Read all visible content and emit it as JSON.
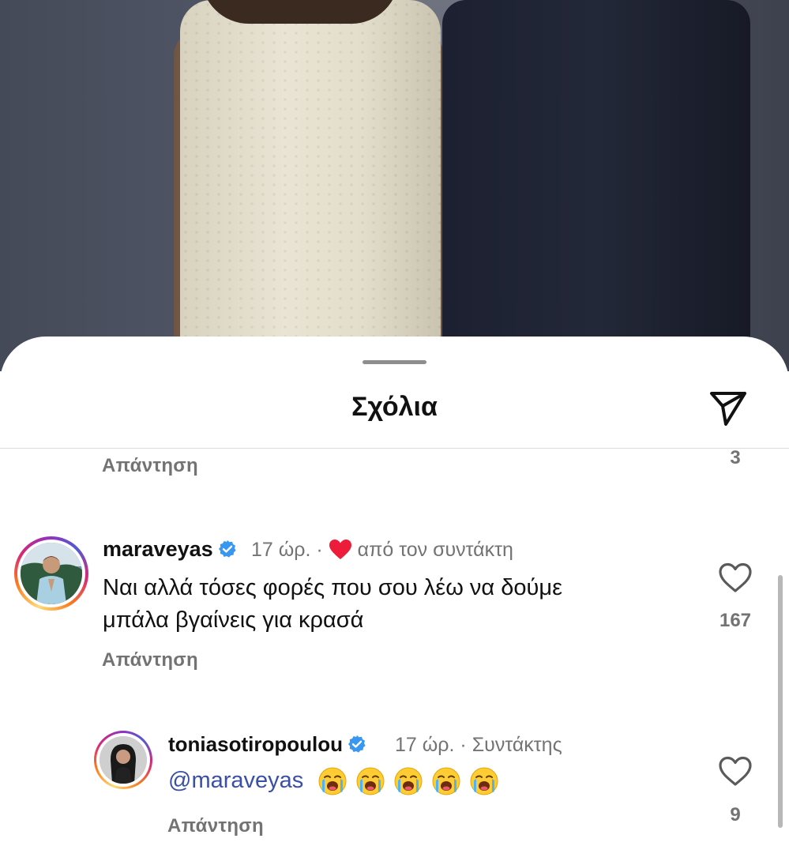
{
  "sheet": {
    "title": "Σχόλια",
    "share_icon": "paper-plane-icon"
  },
  "previous_comment": {
    "reply_label": "Απάντηση",
    "like_count": "3"
  },
  "comment_1": {
    "username": "maraveyas",
    "verified": true,
    "time": "17 ώρ.",
    "separator": "·",
    "liked_by_author_label": "από τον συντάκτη",
    "text_line1": "Ναι αλλά τόσες φορές που σου λέω να δούμε",
    "text_line2": "μπάλα βγαίνεις για κρασά",
    "like_count": "167",
    "reply_label": "Απάντηση"
  },
  "comment_2": {
    "username": "toniasotiropoulou",
    "verified": true,
    "time": "17 ώρ.",
    "separator": "·",
    "role_label": "Συντάκτης",
    "mention": "@maraveyas",
    "emoji_count": 5,
    "emoji_name": "loudly-crying-face",
    "like_count": "9",
    "reply_label": "Απάντηση"
  },
  "colors": {
    "verified_blue": "#3897f0",
    "heart_red": "#ed1c3a",
    "mention_blue": "#3a4fa8",
    "secondary_text": "#737373"
  }
}
